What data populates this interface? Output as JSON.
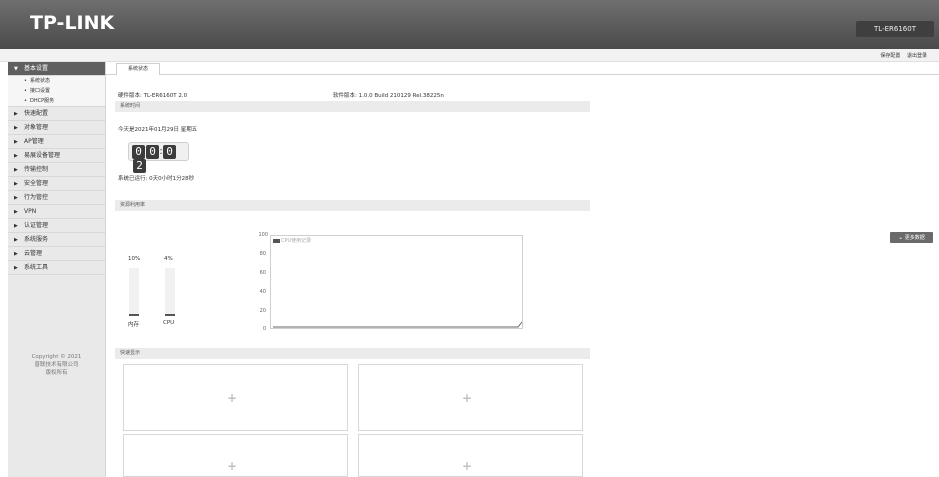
{
  "header": {
    "logo": "TP-LINK",
    "model": "TL-ER6160T"
  },
  "toplinks": {
    "save": "保存配置",
    "logout": "退出登录"
  },
  "sidebar": {
    "groups": [
      {
        "label": "基本设置",
        "subs": [
          "系统状态",
          "接口设置",
          "DHCP服务"
        ]
      },
      {
        "label": "快速配置"
      },
      {
        "label": "对象管理"
      },
      {
        "label": "AP管理"
      },
      {
        "label": "易展设备管理"
      },
      {
        "label": "传输控制"
      },
      {
        "label": "安全管理"
      },
      {
        "label": "行为管控"
      },
      {
        "label": "VPN"
      },
      {
        "label": "认证管理"
      },
      {
        "label": "系统服务"
      },
      {
        "label": "云管理"
      },
      {
        "label": "系统工具"
      }
    ],
    "copyright": [
      "Copyright © 2021",
      "普联技术有限公司",
      "版权所有"
    ]
  },
  "tab": {
    "label": "系统状态"
  },
  "info": {
    "hardware": "硬件版本: TL-ER6160T 2.0",
    "software": "软件版本: 1.0.0 Build 210129 Rel.38225n",
    "time_section": "系统时间",
    "date": "今天是2021年01月29日 星期五",
    "clock": [
      "0",
      "0",
      "0",
      "2"
    ],
    "uptime": "系统已运行: 0天0小时1分28秒"
  },
  "resource": {
    "section": "资源利用率",
    "memory": {
      "label": "内存",
      "percent_text": "10%",
      "value": 10
    },
    "cpu": {
      "label": "CPU",
      "percent_text": "4%",
      "value": 4
    },
    "legend": "CPU使用记录",
    "yticks": [
      "100",
      "80",
      "60",
      "40",
      "20",
      "0"
    ],
    "more": "更多数据"
  },
  "quick": {
    "section": "快速显示"
  },
  "colors": {
    "header": "#555555",
    "accent": "#5f5f5f"
  }
}
